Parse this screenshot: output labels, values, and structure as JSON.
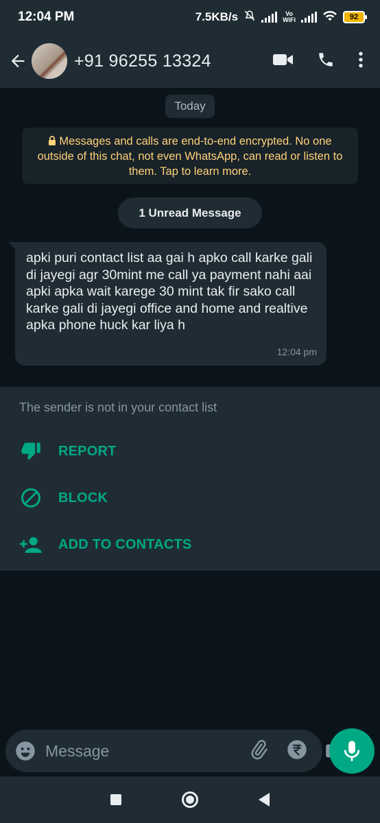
{
  "status_bar": {
    "time": "12:04 PM",
    "net_speed": "7.5KB/s",
    "vowifi_top": "Vo",
    "vowifi_bottom": "WiFi",
    "battery": "92"
  },
  "header": {
    "contact": "+91 96255 13324",
    "icons": [
      "back-arrow-icon",
      "video-call-icon",
      "voice-call-icon",
      "more-options-icon"
    ]
  },
  "chat": {
    "date_chip": "Today",
    "encryption_notice": "Messages and calls are end-to-end encrypted. No one outside of this chat, not even WhatsApp, can read or listen to them. Tap to learn more.",
    "unread_label": "1 Unread Message",
    "message": {
      "text": "apki puri contact list aa gai h  apko call karke  gali di jayegi  agr 30mint me call ya payment nahi aai apki apka wait karege 30 mint tak fir sako call karke gali di jayegi office and home  and realtive  apka phone huck kar liya h",
      "time": "12:04 pm"
    }
  },
  "sender_panel": {
    "note": "The sender is not in your contact list",
    "actions": [
      {
        "label": "REPORT",
        "icon": "thumbs-down-icon"
      },
      {
        "label": "BLOCK",
        "icon": "block-icon"
      },
      {
        "label": "ADD TO CONTACTS",
        "icon": "add-person-icon"
      }
    ]
  },
  "input": {
    "placeholder": "Message",
    "icons": [
      "emoji-icon",
      "attach-icon",
      "rupee-payment-icon",
      "camera-icon",
      "mic-icon"
    ]
  },
  "colors": {
    "accent": "#00a884",
    "background": "#0b141a",
    "panel": "#1f2c34",
    "notice_text": "#ffd279"
  }
}
